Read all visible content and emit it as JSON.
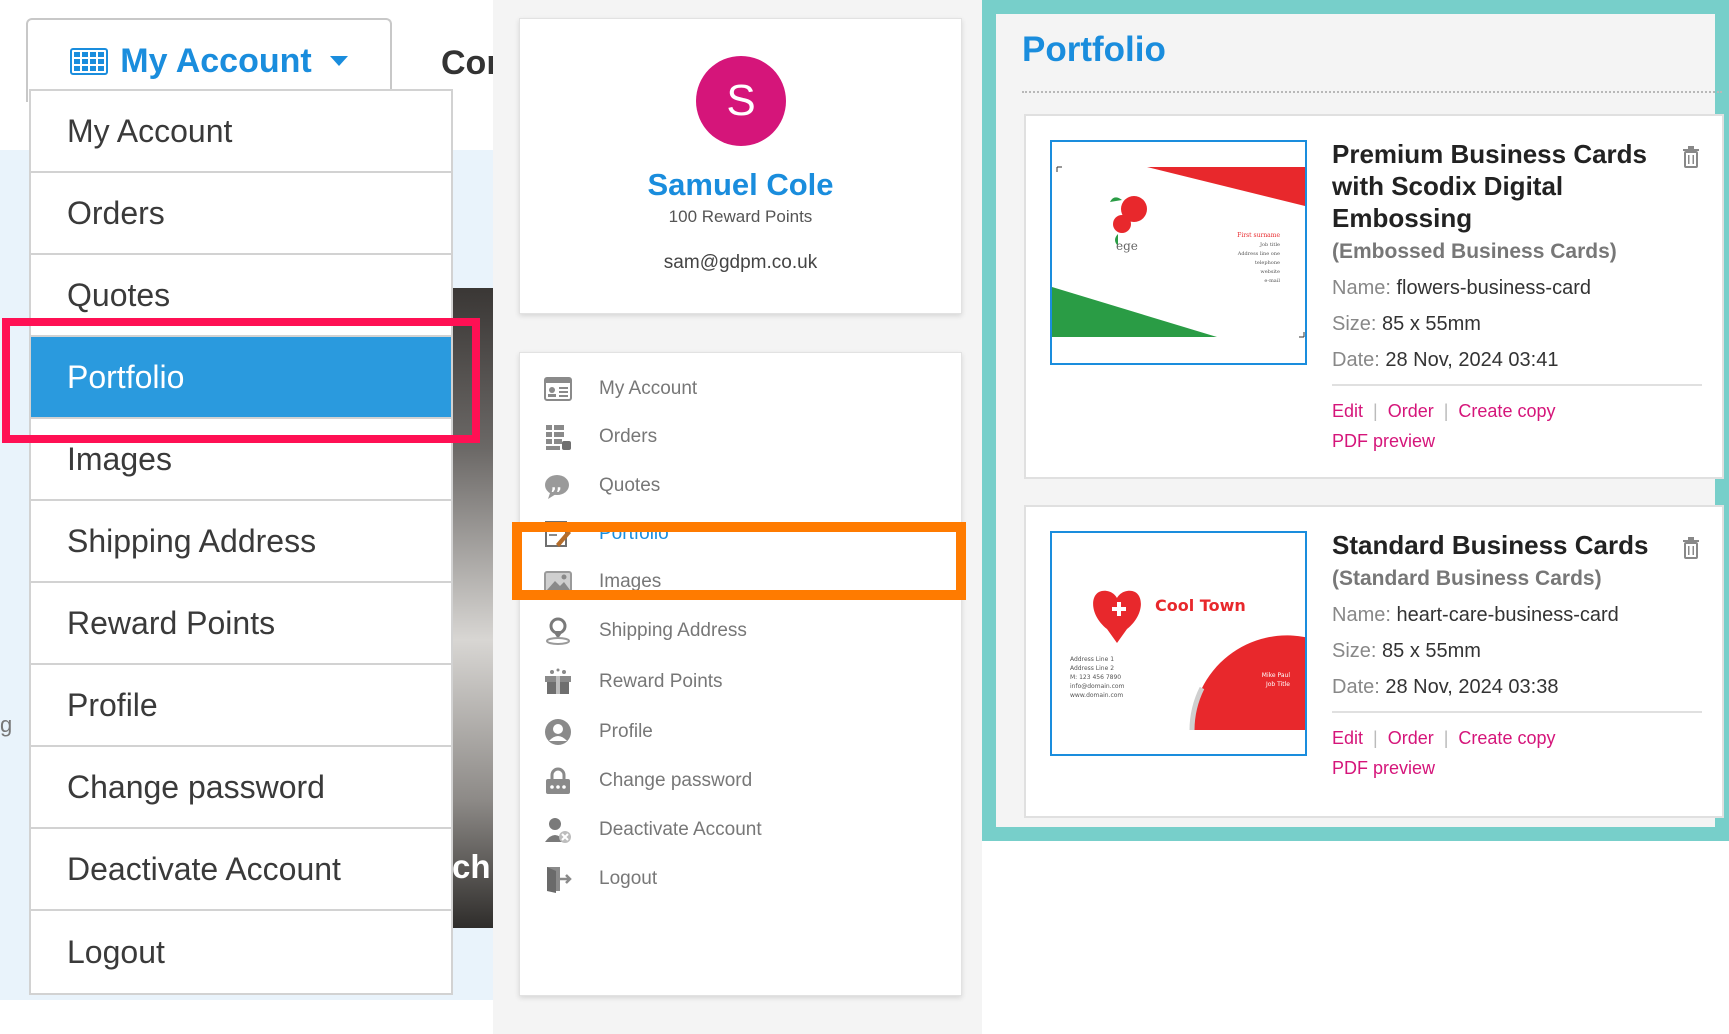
{
  "dropdown": {
    "tab_label": "My Account",
    "next_tab_partial": "Cor",
    "background_text_partial": "ch",
    "edge_letter": "g",
    "items": [
      {
        "label": "My Account"
      },
      {
        "label": "Orders"
      },
      {
        "label": "Quotes"
      },
      {
        "label": "Portfolio",
        "active": true
      },
      {
        "label": "Images"
      },
      {
        "label": "Shipping Address"
      },
      {
        "label": "Reward Points"
      },
      {
        "label": "Profile"
      },
      {
        "label": "Change password"
      },
      {
        "label": "Deactivate Account"
      },
      {
        "label": "Logout"
      }
    ],
    "highlight_color": "#ff1054",
    "active_color": "#2a9ade"
  },
  "profile": {
    "avatar_initial": "S",
    "name": "Samuel Cole",
    "points": "100 Reward Points",
    "email": "sam@gdpm.co.uk",
    "avatar_color": "#d5157a"
  },
  "sidebar": {
    "items": [
      {
        "label": "My Account",
        "icon": "id-card-icon"
      },
      {
        "label": "Orders",
        "icon": "orders-list-icon"
      },
      {
        "label": "Quotes",
        "icon": "quote-bubble-icon"
      },
      {
        "label": "Portfolio",
        "icon": "portfolio-edit-icon",
        "active": true
      },
      {
        "label": "Images",
        "icon": "image-icon"
      },
      {
        "label": "Shipping Address",
        "icon": "location-pin-icon"
      },
      {
        "label": "Reward Points",
        "icon": "gift-box-icon"
      },
      {
        "label": "Profile",
        "icon": "user-circle-icon"
      },
      {
        "label": "Change password",
        "icon": "padlock-icon"
      },
      {
        "label": "Deactivate Account",
        "icon": "user-remove-icon"
      },
      {
        "label": "Logout",
        "icon": "logout-door-icon"
      }
    ],
    "highlight_color": "#ff7b00"
  },
  "portfolio": {
    "title": "Portfolio",
    "items": [
      {
        "title": "Premium Business Cards with Scodix Digital Embossing",
        "category": "(Embossed Business Cards)",
        "name_key": "Name:",
        "name": "flowers-business-card",
        "size_key": "Size:",
        "size": "85 x 55mm",
        "date_key": "Date:",
        "date": "28 Nov, 2024 03:41",
        "links": {
          "edit": "Edit",
          "order": "Order",
          "copy": "Create copy",
          "pdf": "PDF preview"
        },
        "thumb_logo_text": "ege",
        "thumb_lines": [
          "First surname",
          "Job title",
          "Address line one",
          "telephone",
          "website",
          "e-mail"
        ]
      },
      {
        "title": "Standard Business Cards",
        "category": "(Standard Business Cards)",
        "name_key": "Name:",
        "name": "heart-care-business-card",
        "size_key": "Size:",
        "size": "85 x 55mm",
        "date_key": "Date:",
        "date": "28 Nov, 2024 03:38",
        "links": {
          "edit": "Edit",
          "order": "Order",
          "copy": "Create copy",
          "pdf": "PDF preview"
        },
        "thumb_logo_text": "Cool Town",
        "thumb_lines": [
          "Address Line 1",
          "Address Line 2",
          "M: 123 456 7890",
          "info@domain.com",
          "www.domain.com"
        ],
        "thumb_side_lines": [
          "Mike Paul",
          "Job Title"
        ]
      }
    ],
    "frame_color": "#77cfca",
    "link_color": "#d5157a"
  }
}
